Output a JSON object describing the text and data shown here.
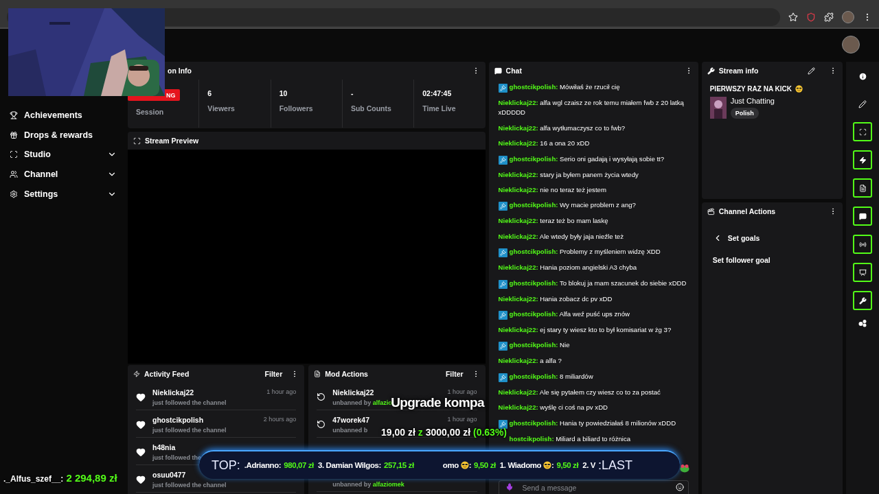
{
  "sidebar": {
    "items": [
      {
        "label": "Achievements",
        "expandable": false
      },
      {
        "label": "Drops & rewards",
        "expandable": false
      },
      {
        "label": "Studio",
        "expandable": true
      },
      {
        "label": "Channel",
        "expandable": true
      },
      {
        "label": "Settings",
        "expandable": true
      }
    ]
  },
  "session_info": {
    "title": "on Info",
    "badge": "NG",
    "badge_label": "Session",
    "stats": [
      {
        "value": "6",
        "label": "Viewers"
      },
      {
        "value": "10",
        "label": "Followers"
      },
      {
        "value": "-",
        "label": "Sub Counts"
      },
      {
        "value": "02:47:45",
        "label": "Time Live"
      }
    ]
  },
  "stream_preview": {
    "title": "Stream Preview"
  },
  "activity_feed": {
    "title": "Activity Feed",
    "filter": "Filter",
    "items": [
      {
        "name": "Nieklickaj22",
        "detail": "just followed the channel",
        "time": "1 hour ago"
      },
      {
        "name": "ghostcikpolish",
        "detail": "just followed the channel",
        "time": "2 hours ago"
      },
      {
        "name": "h48nia",
        "detail": "just followed the"
      },
      {
        "name": "osuu0477",
        "detail": "just followed the channel"
      }
    ]
  },
  "mod_actions": {
    "title": "Mod Actions",
    "filter": "Filter",
    "items": [
      {
        "name": "Nieklickaj22",
        "detail": "unbanned by",
        "moderator": "alfazio",
        "time": "1 hour ago"
      },
      {
        "name": "47worek47",
        "detail": "unbanned b",
        "time": "1 hour ago"
      },
      {
        "detail": "unbanned by",
        "moderator": "alfaziomek"
      }
    ]
  },
  "chat": {
    "title": "Chat",
    "messages": [
      {
        "kind": "mod",
        "user": "ghostcikpolish:",
        "text": "Mówiłaś że rzucił cię"
      },
      {
        "kind": "viewer",
        "user": "Nieklickaj22:",
        "text": "alfa wgl czaisz ze rok temu miałem fwb z 20 latką xDDDDD"
      },
      {
        "kind": "viewer",
        "user": "Nieklickaj22:",
        "text": "alfa wytłumaczysz co to fwb?"
      },
      {
        "kind": "viewer",
        "user": "Nieklickaj22:",
        "text": "16 a ona 20 xDD"
      },
      {
        "kind": "mod",
        "user": "ghostcikpolish:",
        "text": "Serio oni gadają i wysyłają sobie tt?"
      },
      {
        "kind": "viewer",
        "user": "Nieklickaj22:",
        "text": "stary ja byłem panem życia wtedy"
      },
      {
        "kind": "viewer",
        "user": "Nieklickaj22:",
        "text": "nie no teraz też jestem"
      },
      {
        "kind": "mod",
        "user": "ghostcikpolish:",
        "text": "Wy macie problem z ang?"
      },
      {
        "kind": "viewer",
        "user": "Nieklickaj22:",
        "text": "teraz też bo mam laskę"
      },
      {
        "kind": "viewer",
        "user": "Nieklickaj22:",
        "text": "Ale wtedy były jaja nieźle też"
      },
      {
        "kind": "mod",
        "user": "ghostcikpolish:",
        "text": "Problemy z myśleniem widzę XDD"
      },
      {
        "kind": "viewer",
        "user": "Nieklickaj22:",
        "text": "Hania poziom angielski A3 chyba"
      },
      {
        "kind": "mod",
        "user": "ghostcikpolish:",
        "text": "To blokuj ja mam szacunek do siebie xDDD"
      },
      {
        "kind": "viewer",
        "user": "Nieklickaj22:",
        "text": "Hania zobacz dc pv xDD"
      },
      {
        "kind": "mod",
        "user": "ghostcikpolish:",
        "text": "Alfa weź puść ups znów"
      },
      {
        "kind": "viewer",
        "user": "Nieklickaj22:",
        "text": "ej stary ty wiesz kto to był komisariat w żg 3?"
      },
      {
        "kind": "mod",
        "user": "ghostcikpolish:",
        "text": "Nie"
      },
      {
        "kind": "viewer",
        "user": "Nieklickaj22:",
        "text": "a alfa ?"
      },
      {
        "kind": "mod",
        "user": "ghostcikpolish:",
        "text": "8 miliardów"
      },
      {
        "kind": "viewer",
        "user": "Nieklickaj22:",
        "text": "Ale się pytałem czy wiesz co to za postać"
      },
      {
        "kind": "viewer",
        "user": "Nieklickaj22:",
        "text": "wyślę ci coś na pv xDD"
      },
      {
        "kind": "mod",
        "user": "ghostcikpolish:",
        "text": "Hania ty powiedziałaś 8 milionów xDDD"
      },
      {
        "kind": "covered_badge",
        "user": "hostcikpolish:",
        "text": "Miliard a biliard to różnica"
      }
    ],
    "input": {
      "placeholder": "Send a message"
    }
  },
  "stream_info": {
    "title": "Stream info",
    "stream_title": "PIERWSZY RAZ NA KICK",
    "category": "Just Chatting",
    "tags": [
      "Polish"
    ]
  },
  "channel_actions": {
    "title": "Channel Actions",
    "back": "Set goals",
    "items": [
      "Set follower goal"
    ]
  },
  "overlays": {
    "goal": {
      "title": "Upgrade kompa",
      "current": "19,00 zł",
      "separator": "z",
      "target": "3000,00 zł",
      "percent": "(0.63%)"
    },
    "ticker": {
      "label": "TOP:",
      "entries": [
        {
          "name": ".Adrianno:",
          "amount": "980,07 zł"
        },
        {
          "name": "3. Damian Wilgos:",
          "amount": "257,15 zł"
        },
        {
          "name": "omo",
          "after_emoji": ":",
          "amount": "9,50 zł"
        },
        {
          "name": "1. Wiadomo",
          "after_emoji": ":",
          "amount": "9,50 zł"
        },
        {
          "name": "2. V"
        }
      ],
      "tail": ":LAST"
    },
    "top_donor": {
      "name": "._Alfus_szef__:",
      "amount": "2 294,89 zł"
    }
  }
}
